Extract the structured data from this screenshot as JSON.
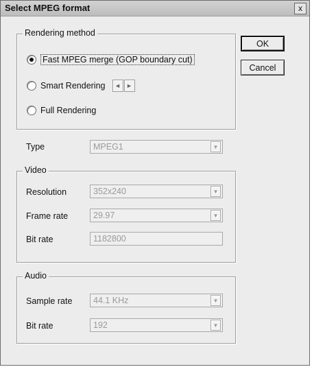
{
  "dialog": {
    "title": "Select MPEG format",
    "close_label": "x"
  },
  "buttons": {
    "ok": "OK",
    "cancel": "Cancel"
  },
  "rendering": {
    "legend": "Rendering method",
    "options": [
      {
        "label": "Fast MPEG merge (GOP boundary cut)",
        "checked": true
      },
      {
        "label": "Smart Rendering",
        "checked": false
      },
      {
        "label": "Full Rendering",
        "checked": false
      }
    ],
    "spin_left": "◄",
    "spin_right": "►"
  },
  "type": {
    "label": "Type",
    "value": "MPEG1"
  },
  "video": {
    "legend": "Video",
    "resolution_label": "Resolution",
    "resolution_value": "352x240",
    "framerate_label": "Frame rate",
    "framerate_value": "29.97",
    "bitrate_label": "Bit rate",
    "bitrate_value": "1182800"
  },
  "audio": {
    "legend": "Audio",
    "samplerate_label": "Sample rate",
    "samplerate_value": "44.1 KHz",
    "bitrate_label": "Bit rate",
    "bitrate_value": "192"
  },
  "icons": {
    "dropdown": "▼"
  }
}
